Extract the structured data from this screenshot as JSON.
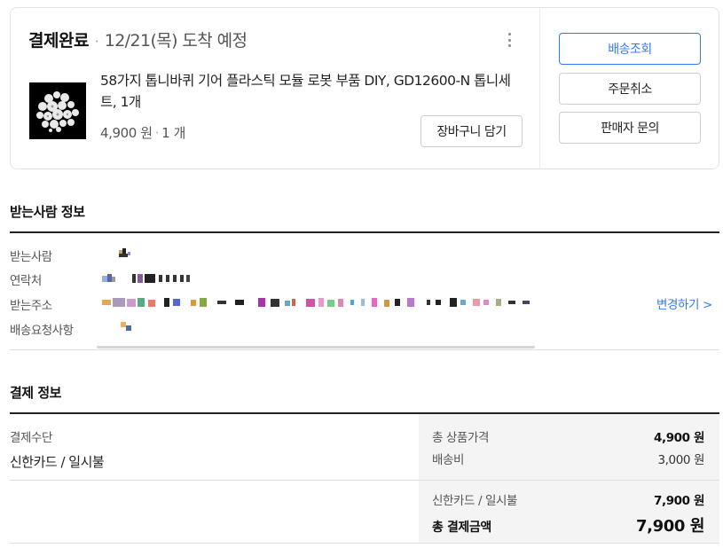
{
  "order": {
    "status": "결제완료",
    "separator": "·",
    "arrival": "12/21(목) 도착 예정",
    "product_name": "58가지 톱니바퀴 기어 플라스틱 모듈 로봇 부품 DIY, GD12600-N 톱니세트, 1개",
    "price": "4,900 원",
    "meta_sep": "·",
    "quantity": "1 개",
    "cart_button": "장바구니 담기",
    "more_icon": "kebab-vertical-icon"
  },
  "side_actions": {
    "track": "배송조회",
    "cancel": "주문취소",
    "inquiry": "판매자 문의"
  },
  "recipient": {
    "title": "받는사람 정보",
    "labels": [
      "받는사람",
      "연락처",
      "받는주소",
      "배송요청사항"
    ],
    "change_link": "변경하기 >"
  },
  "payment": {
    "title": "결제 정보",
    "method_label": "결제수단",
    "method_value": "신한카드 / 일시불",
    "product_total_label": "총 상품가격",
    "product_total_value": "4,900 원",
    "shipping_label": "배송비",
    "shipping_value": "3,000 원",
    "card_label": "신한카드 / 일시불",
    "card_value": "7,900 원",
    "grand_total_label": "총 결제금액",
    "grand_total_value": "7,900 원"
  },
  "colors": {
    "accent": "#3478f6",
    "text": "#111111",
    "muted": "#555555",
    "panel": "#f4f4f4"
  }
}
